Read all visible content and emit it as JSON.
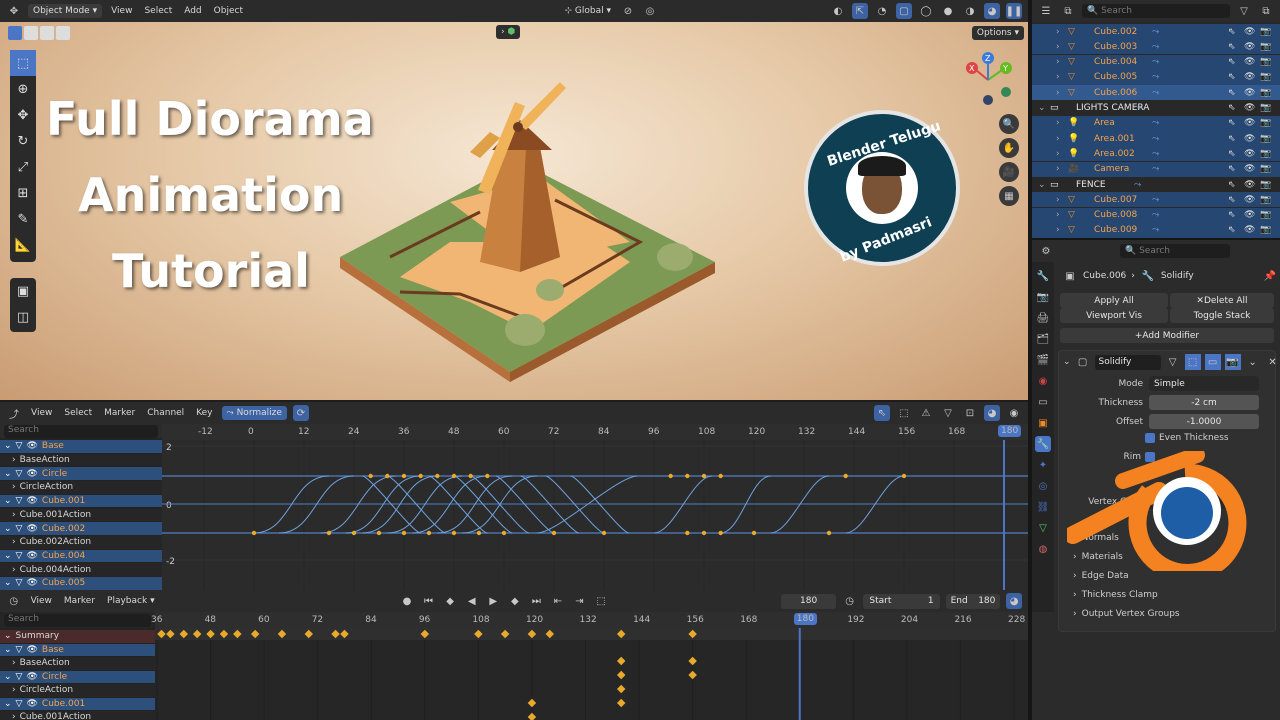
{
  "viewport": {
    "mode": "Object Mode",
    "menus": [
      "View",
      "Select",
      "Add",
      "Object"
    ],
    "orientation": "Global",
    "options": "Options",
    "title_lines": [
      "Full Diorama",
      "Animation",
      "Tutorial"
    ],
    "badge_lines": [
      "Blender Telugu",
      "by Padmasri"
    ]
  },
  "outliner": {
    "search_placeholder": "Search",
    "rows": [
      {
        "label": "Cube.002",
        "kind": "mesh",
        "sel": true
      },
      {
        "label": "Cube.003",
        "kind": "mesh",
        "sel": true
      },
      {
        "label": "Cube.004",
        "kind": "mesh",
        "sel": true
      },
      {
        "label": "Cube.005",
        "kind": "mesh",
        "sel": true
      },
      {
        "label": "Cube.006",
        "kind": "mesh",
        "sel": true,
        "active": true
      },
      {
        "label": "LIGHTS CAMERA",
        "kind": "collection",
        "sel": false
      },
      {
        "label": "Area",
        "kind": "light",
        "sel": true
      },
      {
        "label": "Area.001",
        "kind": "light",
        "sel": true
      },
      {
        "label": "Area.002",
        "kind": "light",
        "sel": true
      },
      {
        "label": "Camera",
        "kind": "camera",
        "sel": true
      },
      {
        "label": "FENCE",
        "kind": "collection",
        "sel": false
      },
      {
        "label": "Cube.007",
        "kind": "mesh",
        "sel": true
      },
      {
        "label": "Cube.008",
        "kind": "mesh",
        "sel": true
      },
      {
        "label": "Cube.009",
        "kind": "mesh",
        "sel": true
      }
    ]
  },
  "properties": {
    "search_placeholder": "Search",
    "breadcrumb_object": "Cube.006",
    "breadcrumb_modifier": "Solidify",
    "apply_all": "Apply All",
    "delete_all": "Delete All",
    "viewport_vis": "Viewport Vis",
    "toggle_stack": "Toggle Stack",
    "add_modifier": "Add Modifier",
    "modifier_name": "Solidify",
    "mode_label": "Mode",
    "mode_value": "Simple",
    "thickness_label": "Thickness",
    "thickness_value": "-2 cm",
    "offset_label": "Offset",
    "offset_value": "-1.0000",
    "even_thickness": "Even Thickness",
    "rim_label": "Rim",
    "vertex_group_label": "Vertex G",
    "sections": [
      "Normals",
      "Materials",
      "Edge Data",
      "Thickness Clamp",
      "Output Vertex Groups"
    ]
  },
  "graph": {
    "menus": [
      "View",
      "Select",
      "Marker",
      "Channel",
      "Key"
    ],
    "normalize": "Normalize",
    "search_placeholder": "Search",
    "frames": [
      "-12",
      "0",
      "12",
      "24",
      "36",
      "48",
      "60",
      "72",
      "84",
      "96",
      "108",
      "120",
      "132",
      "144",
      "156",
      "168",
      "180"
    ],
    "current_frame": "180",
    "y_labels": [
      "2",
      "0",
      "-2"
    ],
    "channels": [
      {
        "label": "Base",
        "type": "obj"
      },
      {
        "label": "BaseAction",
        "type": "act"
      },
      {
        "label": "Circle",
        "type": "obj"
      },
      {
        "label": "CircleAction",
        "type": "act"
      },
      {
        "label": "Cube.001",
        "type": "obj"
      },
      {
        "label": "Cube.001Action",
        "type": "act"
      },
      {
        "label": "Cube.002",
        "type": "obj"
      },
      {
        "label": "Cube.002Action",
        "type": "act"
      },
      {
        "label": "Cube.004",
        "type": "obj"
      },
      {
        "label": "Cube.004Action",
        "type": "act"
      },
      {
        "label": "Cube.005",
        "type": "obj"
      }
    ]
  },
  "dopesheet": {
    "menus": [
      "View",
      "Marker"
    ],
    "playback": "Playback",
    "current_frame": "180",
    "start_label": "Start",
    "start_value": "1",
    "end_label": "End",
    "end_value": "180",
    "search_placeholder": "Search",
    "frames": [
      "36",
      "48",
      "60",
      "72",
      "84",
      "96",
      "108",
      "120",
      "132",
      "144",
      "156",
      "168",
      "180",
      "192",
      "204",
      "216",
      "228"
    ],
    "channels": [
      {
        "label": "Summary",
        "type": "summary"
      },
      {
        "label": "Base",
        "type": "obj"
      },
      {
        "label": "BaseAction",
        "type": "act"
      },
      {
        "label": "Circle",
        "type": "obj"
      },
      {
        "label": "CircleAction",
        "type": "act"
      },
      {
        "label": "Cube.001",
        "type": "obj"
      },
      {
        "label": "Cube.001Action",
        "type": "act"
      }
    ]
  },
  "colors": {
    "accent": "#4a76c5",
    "orange": "#f58220",
    "keyframe": "#e9a92b"
  }
}
